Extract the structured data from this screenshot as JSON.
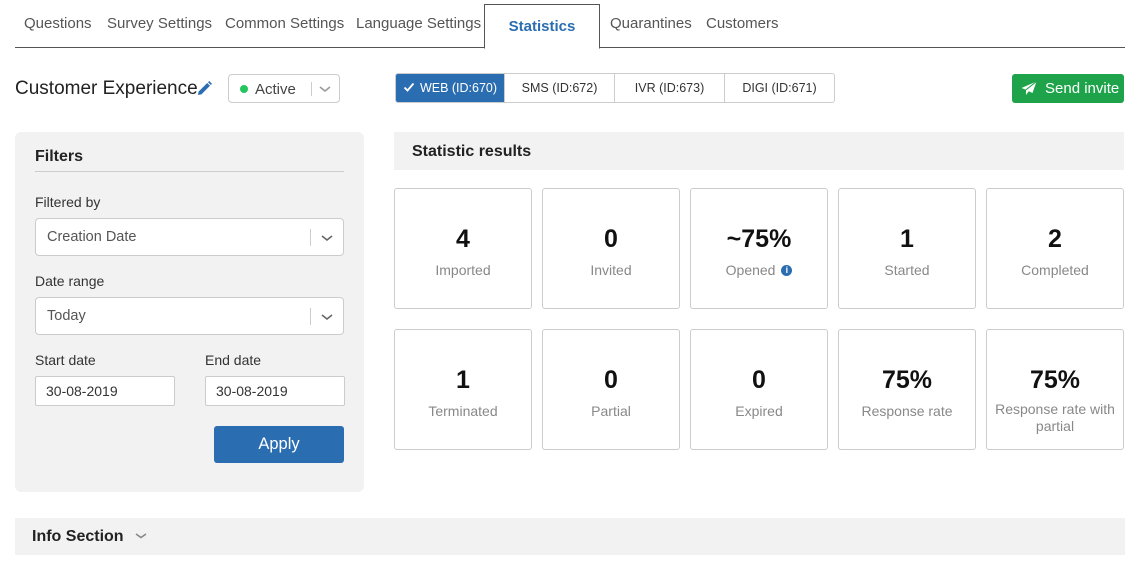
{
  "tabs": [
    {
      "label": "Questions",
      "active": false
    },
    {
      "label": "Survey Settings",
      "active": false
    },
    {
      "label": "Common Settings",
      "active": false
    },
    {
      "label": "Language Settings",
      "active": false
    },
    {
      "label": "Statistics",
      "active": true
    },
    {
      "label": "Quarantines",
      "active": false
    },
    {
      "label": "Customers",
      "active": false
    }
  ],
  "survey": {
    "title": "Customer Experience",
    "status": "Active",
    "status_color": "#22c55e"
  },
  "channels": [
    {
      "label": "WEB (ID:670)",
      "active": true
    },
    {
      "label": "SMS (ID:672)",
      "active": false
    },
    {
      "label": "IVR (ID:673)",
      "active": false
    },
    {
      "label": "DIGI (ID:671)",
      "active": false
    }
  ],
  "send_invite": {
    "label": "Send invite",
    "color": "#1ea34a"
  },
  "filters": {
    "title": "Filters",
    "filtered_by_label": "Filtered by",
    "filtered_by_value": "Creation Date",
    "date_range_label": "Date range",
    "date_range_value": "Today",
    "start_date_label": "Start date",
    "start_date_value": "30-08-2019",
    "end_date_label": "End date",
    "end_date_value": "30-08-2019",
    "apply_label": "Apply"
  },
  "stats": {
    "title": "Statistic results",
    "cards": [
      {
        "value": "4",
        "label": "Imported"
      },
      {
        "value": "0",
        "label": "Invited"
      },
      {
        "value": "~75%",
        "label": "Opened",
        "info_icon": "i"
      },
      {
        "value": "1",
        "label": "Started"
      },
      {
        "value": "2",
        "label": "Completed"
      },
      {
        "value": "1",
        "label": "Terminated"
      },
      {
        "value": "0",
        "label": "Partial"
      },
      {
        "value": "0",
        "label": "Expired"
      },
      {
        "value": "75%",
        "label": "Response rate"
      },
      {
        "value": "75%",
        "label": "Response rate with partial"
      }
    ]
  },
  "info_section": {
    "title": "Info Section"
  },
  "colors": {
    "accent": "#2a6db0",
    "panel": "#f2f2f2"
  }
}
